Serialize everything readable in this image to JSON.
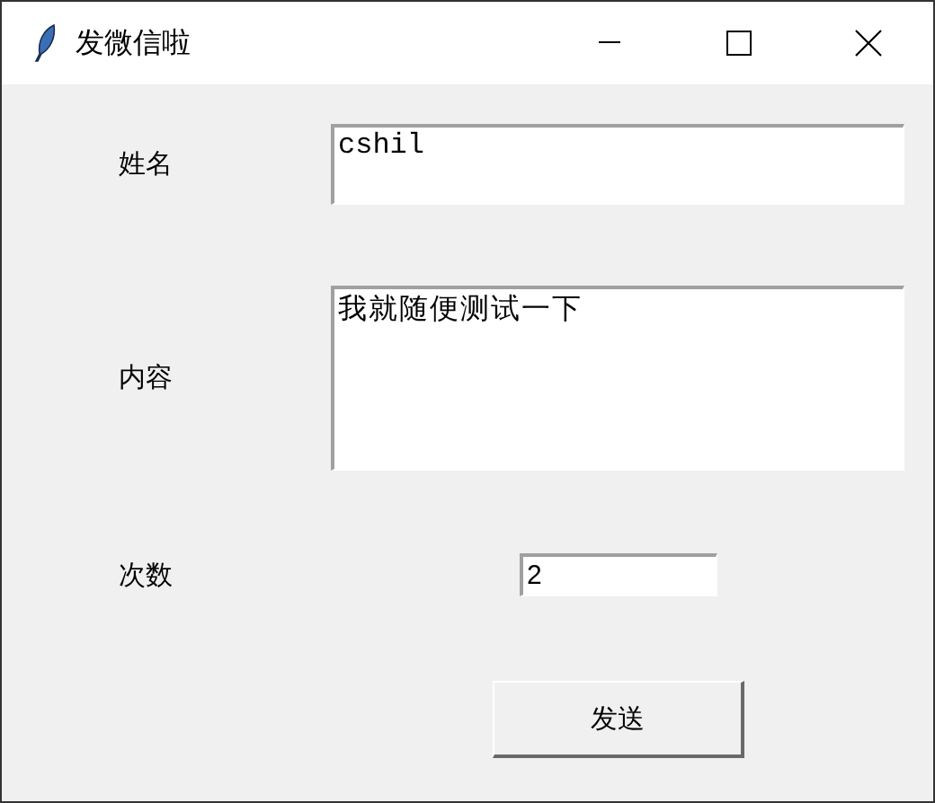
{
  "window": {
    "title": "发微信啦"
  },
  "fields": [
    {
      "kind": "line",
      "label": "姓名",
      "value": "cshil"
    },
    {
      "kind": "text",
      "label": "内容",
      "value": "我就随便测试一下"
    },
    {
      "kind": "short",
      "label": "次数",
      "value": "2"
    }
  ],
  "buttons": [
    "发送"
  ]
}
